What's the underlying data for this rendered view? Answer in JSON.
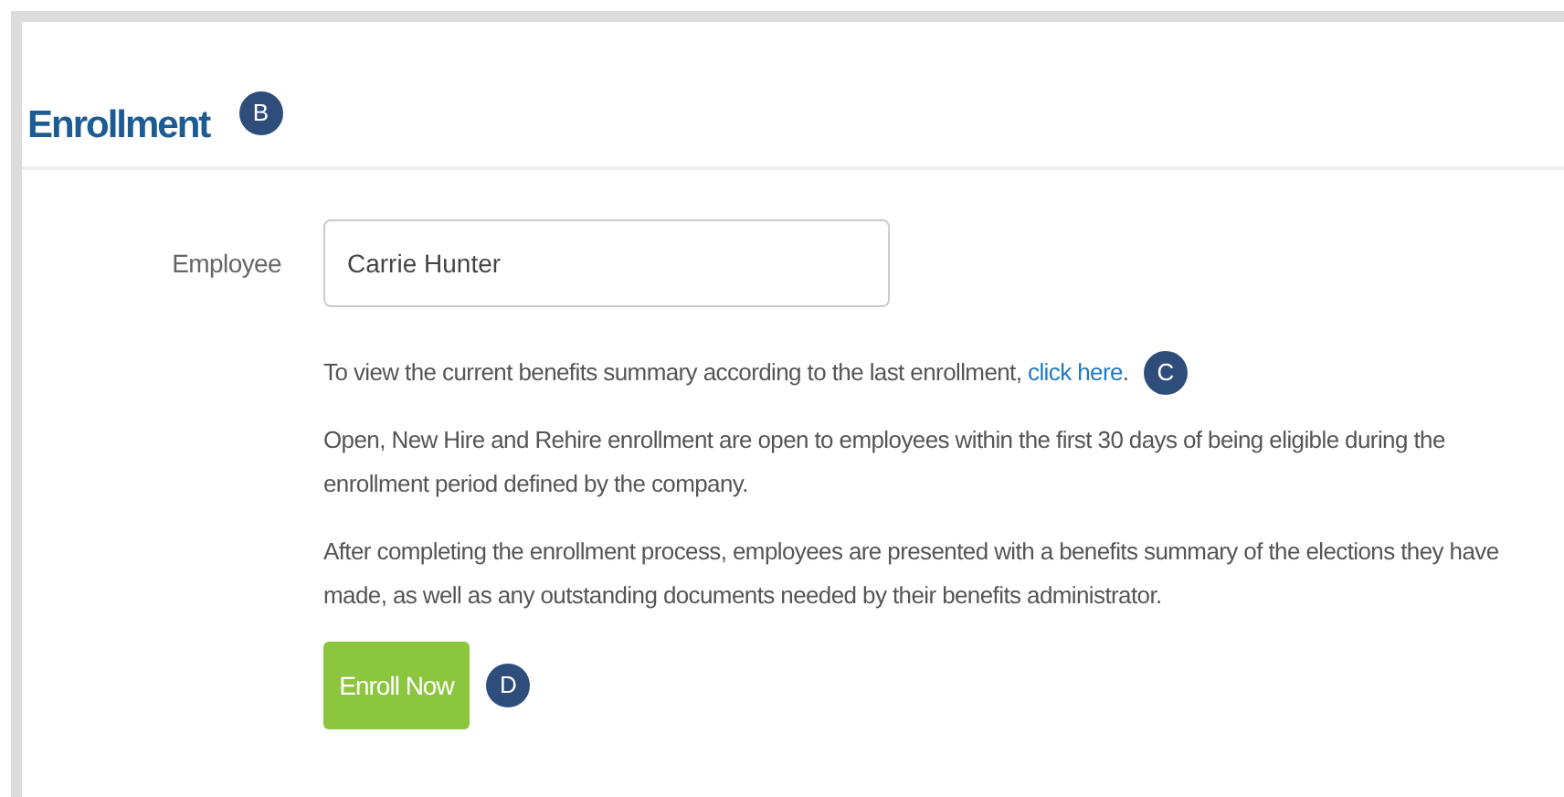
{
  "section": {
    "title": "Enrollment",
    "callout": "B"
  },
  "employee_field": {
    "label": "Employee",
    "value": "Carrie Hunter"
  },
  "summary_note": {
    "text": "To view the current benefits summary according to the last enrollment, ",
    "link": "click here",
    "after": ".",
    "callout": "C"
  },
  "paragraphs": [
    "Open, New Hire and Rehire enrollment are open to employees within the first 30 days of being eligible during the enrollment period defined by the company.",
    "After completing the enrollment process, employees are presented with a benefits summary of the elections they have made, as well as any outstanding documents needed by their benefits administrator."
  ],
  "enroll_button": {
    "label": "Enroll Now",
    "callout": "D"
  }
}
